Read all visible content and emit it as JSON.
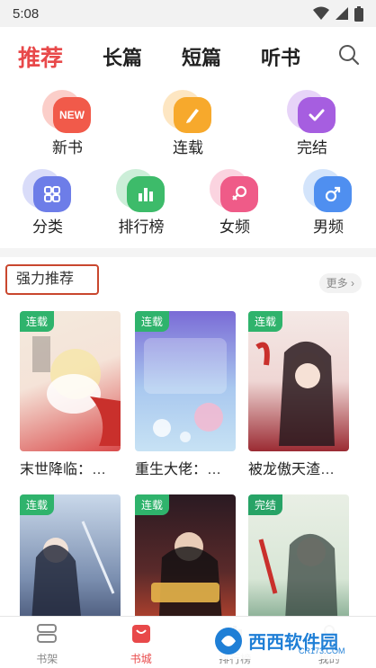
{
  "status_bar": {
    "time": "5:08"
  },
  "top_tabs": [
    {
      "label": "推荐",
      "active": true
    },
    {
      "label": "长篇",
      "active": false
    },
    {
      "label": "短篇",
      "active": false
    },
    {
      "label": "听书",
      "active": false
    }
  ],
  "categories": [
    {
      "label": "新书",
      "icon": "new-icon",
      "badge_text": "NEW",
      "color": "#f15a4a"
    },
    {
      "label": "连载",
      "icon": "pencil-icon",
      "color": "#f7a92c"
    },
    {
      "label": "完结",
      "icon": "check-icon",
      "color": "#a65ee0"
    },
    {
      "label": "分类",
      "icon": "grid-icon",
      "color": "#6d7de8"
    },
    {
      "label": "排行榜",
      "icon": "bar-chart-icon",
      "color": "#3dbb6a"
    },
    {
      "label": "女频",
      "icon": "female-icon",
      "color": "#ef5b88"
    },
    {
      "label": "男频",
      "icon": "male-icon",
      "color": "#4f8ff0"
    }
  ],
  "section": {
    "title": "强力推荐",
    "more_label": "更多"
  },
  "books": [
    {
      "badge": "连载",
      "title": "末世降临：…",
      "cover_colors": [
        "#f3eadd",
        "#d94b4b"
      ]
    },
    {
      "badge": "连载",
      "title": "重生大佬：…",
      "cover_colors": [
        "#7a6bd6",
        "#c7e2f4"
      ]
    },
    {
      "badge": "连载",
      "title": "被龙傲天渣…",
      "cover_colors": [
        "#f4e9e6",
        "#9b2b33"
      ]
    },
    {
      "badge": "连载",
      "title": "",
      "cover_colors": [
        "#c9d8ea",
        "#3c4a6b"
      ]
    },
    {
      "badge": "连载",
      "title": "",
      "cover_colors": [
        "#2a1a22",
        "#c9482f"
      ]
    },
    {
      "badge": "完结",
      "title": "",
      "cover_colors": [
        "#e9efe5",
        "#6b9a7c"
      ]
    }
  ],
  "bottom_nav": [
    {
      "label": "书架",
      "icon": "bookshelf-icon",
      "active": false
    },
    {
      "label": "书城",
      "icon": "bookstore-icon",
      "active": true
    },
    {
      "label": "排行榜",
      "icon": "rank-icon",
      "active": false
    },
    {
      "label": "我的",
      "icon": "profile-icon",
      "active": false
    }
  ],
  "watermark": {
    "text": "西西软件园",
    "sub": "CR173.COM"
  },
  "colors": {
    "accent": "#e8494a",
    "badge_green": "#2fb36c"
  }
}
